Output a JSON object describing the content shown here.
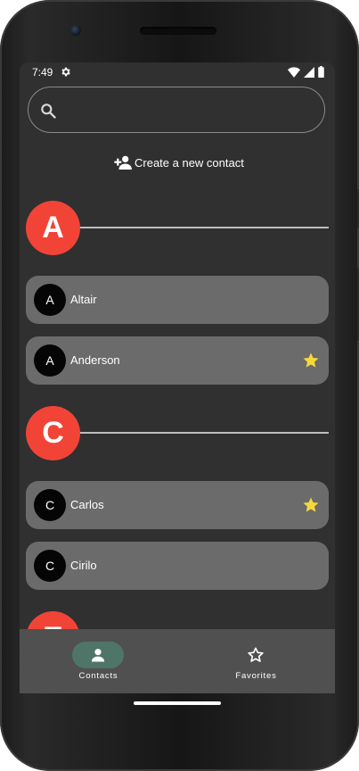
{
  "status_bar": {
    "time": "7:49"
  },
  "search": {
    "value": "",
    "placeholder": ""
  },
  "create_contact": {
    "label": "Create a new contact"
  },
  "sections": [
    {
      "letter": "A",
      "contacts": [
        {
          "initial": "A",
          "name": "Altair",
          "favorite": false
        },
        {
          "initial": "A",
          "name": "Anderson",
          "favorite": true
        }
      ]
    },
    {
      "letter": "C",
      "contacts": [
        {
          "initial": "C",
          "name": "Carlos",
          "favorite": true
        },
        {
          "initial": "C",
          "name": "Cirilo",
          "favorite": false
        }
      ]
    },
    {
      "letter": "E",
      "contacts": []
    }
  ],
  "bottom_nav": {
    "items": [
      {
        "label": "Contacts",
        "icon": "person-icon",
        "selected": true
      },
      {
        "label": "Favorites",
        "icon": "star-outline-icon",
        "selected": false
      }
    ]
  },
  "colors": {
    "screen_background": "#303030",
    "section_accent": "#f14437",
    "card_background": "#6b6b6b",
    "avatar_background": "#050505",
    "favorite_star": "#f7d83a",
    "nav_background": "#505050",
    "nav_selected_pill": "#4e7568"
  }
}
